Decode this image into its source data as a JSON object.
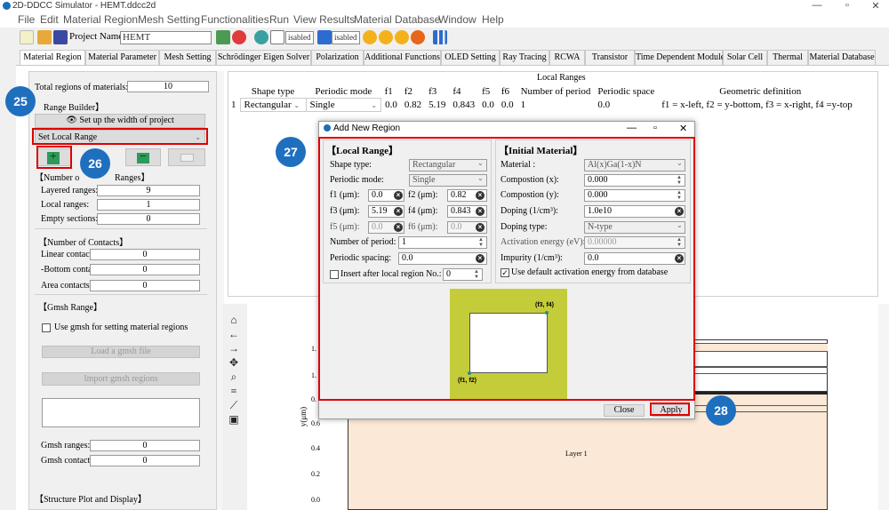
{
  "window": {
    "title": "2D-DDCC Simulator - HEMT.ddcc2d",
    "min": "—",
    "max": "▫",
    "close": "✕"
  },
  "menu": [
    "File",
    "Edit",
    "Material Region",
    "Mesh Setting",
    "Functionalities",
    "Run",
    "View Results",
    "Material Database",
    "Window",
    "Help"
  ],
  "toolbar": {
    "project_label": "Project Name:",
    "project_value": "HEMT",
    "disabled1": "isabled",
    "disabled2": "isabled"
  },
  "tabs": [
    "Material Region",
    "Material Parameter",
    "Mesh Setting",
    "Schrödinger Eigen Solver",
    "Polarization",
    "Additional Functions",
    "OLED Setting",
    "Ray Tracing",
    "RCWA",
    "Transistor",
    "Time Dependent Module",
    "Solar Cell",
    "Thermal",
    "Material Database"
  ],
  "left": {
    "total_label": "Total regions of materials:",
    "total_value": "10",
    "range_builder": "Range Builder】",
    "setup_width": "Set up the width of project",
    "set_local_range": "Set Local Range",
    "number_ranges_a": "【Number o",
    "number_ranges_b": "Ranges】",
    "layered_label": "Layered ranges:",
    "layered_value": "9",
    "local_label": "Local ranges:",
    "local_value": "1",
    "empty_label": "Empty sections:",
    "empty_value": "0",
    "contacts_header": "【Number of Contacts】",
    "linear_label": "Linear contact",
    "linear_value": "0",
    "bottom_label": "-Bottom conta",
    "bottom_value": "0",
    "area_label": "Area contacts:",
    "area_value": "0",
    "gmsh_header": "【Gmsh Range】",
    "use_gmsh": "Use gmsh for setting material regions",
    "load_gmsh": "Load a gmsh file",
    "import_gmsh": "Import gmsh regions",
    "gmsh_ranges_label": "Gmsh ranges:",
    "gmsh_ranges_value": "0",
    "gmsh_contacts_label": "Gmsh contacts:",
    "gmsh_contacts_value": "0",
    "structure_header": "【Structure Plot and Display】"
  },
  "local_ranges": {
    "title": "Local Ranges",
    "headers": [
      "Shape type",
      "Periodic mode",
      "f1",
      "f2",
      "f3",
      "f4",
      "f5",
      "f6",
      "Number of period",
      "Periodic space",
      "Geometric definition"
    ],
    "row": {
      "index": "1",
      "shape": "Rectangular",
      "mode": "Single",
      "f1": "0.0",
      "f2": "0.82",
      "f3": "5.19",
      "f4": "0.843",
      "f5": "0.0",
      "f6": "0.0",
      "num_period": "1",
      "space": "0.0",
      "geom": "f1 = x-left, f2 = y-bottom, f3 = x-right, f4 =y-top"
    }
  },
  "plot": {
    "ylabel": "y(μm)",
    "yticks": [
      "1.",
      "1.",
      "0.",
      "0.6",
      "0.4",
      "0.2",
      "0.0"
    ],
    "layer_label": "Layer 1"
  },
  "dialog": {
    "title": "Add New Region",
    "local_header": "【Local Range】",
    "shape_label": "Shape type:",
    "shape_value": "Rectangular",
    "mode_label": "Periodic mode:",
    "mode_value": "Single",
    "f1_label": "f1 (μm):",
    "f1_value": "0.0",
    "f2_label": "f2 (μm):",
    "f2_value": "0.82",
    "f3_label": "f3 (μm):",
    "f3_value": "5.19",
    "f4_label": "f4 (μm):",
    "f4_value": "0.843",
    "f5_label": "f5 (μm):",
    "f5_value": "0.0",
    "f6_label": "f6 (μm):",
    "f6_value": "0.0",
    "period_label": "Number of period:",
    "period_value": "1",
    "spacing_label": "Periodic spacing:",
    "spacing_value": "0.0",
    "insert_label": "Insert after local region No.:",
    "insert_value": "0",
    "init_header": "【Initial Material】",
    "material_label": "Material :",
    "material_value": "Al(x)Ga(1-x)N",
    "compx_label": "Compostion (x):",
    "compx_value": "0.000",
    "compy_label": "Compostion (y):",
    "compy_value": "0.000",
    "doping_label": "Doping (1/cm³):",
    "doping_value": "1.0e10",
    "dtype_label": "Doping type:",
    "dtype_value": "N-type",
    "act_label": "Activation energy (eV):",
    "act_value": "0.00000",
    "imp_label": "Impurity (1/cm³):",
    "imp_value": "0.0",
    "use_default": "Use default activation energy from database",
    "corner_top": "(f3, f4)",
    "corner_bottom": "(f1, f2)",
    "close": "Close",
    "apply": "Apply"
  },
  "badges": [
    "25",
    "26",
    "27",
    "28"
  ],
  "colors": {
    "annot_red": "#e00000",
    "badge_blue": "#1f6fbf",
    "preview_bg": "#c4cc3a",
    "layer_fill": "#fbe8d6"
  }
}
